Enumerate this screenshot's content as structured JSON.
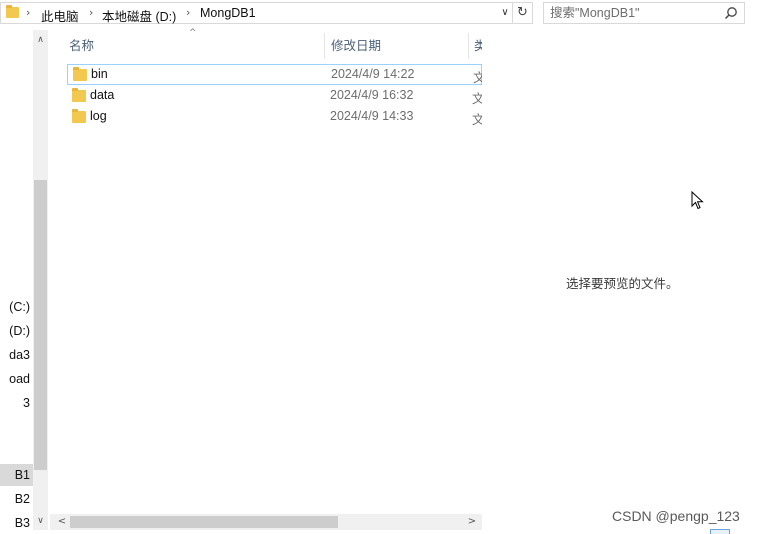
{
  "address_bar": {
    "crumbs": [
      "此电脑",
      "本地磁盘 (D:)",
      "MongDB1"
    ]
  },
  "search": {
    "placeholder": "搜索\"MongDB1\""
  },
  "nav_pane": {
    "items": [
      {
        "label": "(C:)",
        "selected": false
      },
      {
        "label": "(D:)",
        "selected": false
      },
      {
        "label": "da3",
        "selected": false
      },
      {
        "label": "oad",
        "selected": false
      },
      {
        "label": "3",
        "selected": false
      },
      {
        "label": "B1",
        "selected": true
      },
      {
        "label": "B2",
        "selected": false
      },
      {
        "label": "B3",
        "selected": false
      }
    ]
  },
  "file_list": {
    "columns": {
      "name": "名称",
      "modified": "修改日期",
      "type": "类"
    },
    "rows": [
      {
        "name": "bin",
        "modified": "2024/4/9 14:22",
        "type": "文件夹"
      },
      {
        "name": "data",
        "modified": "2024/4/9 16:32",
        "type": "文件夹"
      },
      {
        "name": "log",
        "modified": "2024/4/9 14:33",
        "type": "文件夹"
      }
    ]
  },
  "preview": {
    "message": "选择要预览的文件。"
  },
  "watermark": "CSDN @pengp_123",
  "colors": {
    "folder": "#f3c84e",
    "header_text": "#4c607a",
    "focus_border": "#99d1ff"
  }
}
